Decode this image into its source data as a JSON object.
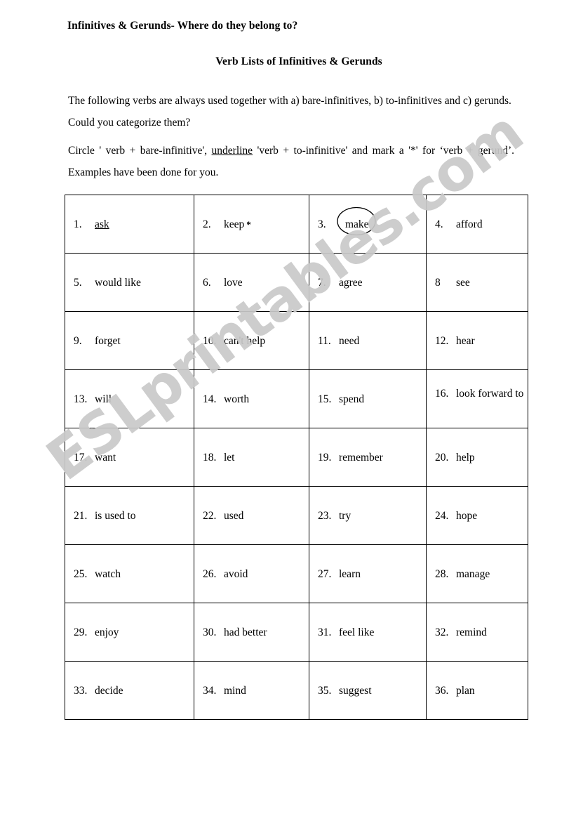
{
  "document": {
    "title_main": "Infinitives & Gerunds- Where do they belong to?",
    "title_sub": "Verb Lists of Infinitives & Gerunds",
    "intro_paragraph": "The following verbs are always used together with a) bare-infinitives, b) to-infinitives and c) gerunds.   Could you categorize them?",
    "task_line1_a": "Circle ' verb + bare-infinitive', ",
    "task_line1_underlined": "underline",
    "task_line1_b": " 'verb + to-infinitive' and mark a '*' for ‘verb +",
    "task_line2": "gerund’.   Examples have been done for you.",
    "watermark": "ESLprintables.com",
    "watermark_color": "#c9c9c9"
  },
  "table": {
    "columns": 4,
    "rows": 9,
    "cells": [
      {
        "num": "1.",
        "word": "ask",
        "mark": "underline"
      },
      {
        "num": "2.",
        "word": "keep",
        "mark": "asterisk"
      },
      {
        "num": "3.",
        "word": "make",
        "mark": "circle"
      },
      {
        "num": "4.",
        "word": "afford",
        "mark": "none"
      },
      {
        "num": "5.",
        "word": "would like",
        "mark": "none"
      },
      {
        "num": "6.",
        "word": "love",
        "mark": "none"
      },
      {
        "num": "7.",
        "word": "agree",
        "mark": "none"
      },
      {
        "num": "8",
        "word": "see",
        "mark": "none"
      },
      {
        "num": "9.",
        "word": "forget",
        "mark": "none"
      },
      {
        "num": "10.",
        "word": "can't help",
        "mark": "none"
      },
      {
        "num": "11.",
        "word": "need",
        "mark": "none"
      },
      {
        "num": "12.",
        "word": "hear",
        "mark": "none"
      },
      {
        "num": "13.",
        "word": "will",
        "mark": "none"
      },
      {
        "num": "14.",
        "word": "worth",
        "mark": "none"
      },
      {
        "num": "15.",
        "word": "spend",
        "mark": "none"
      },
      {
        "num": "16.",
        "word": "look forward to",
        "mark": "none",
        "wrap": true
      },
      {
        "num": "17.",
        "word": "want",
        "mark": "none"
      },
      {
        "num": "18.",
        "word": "let",
        "mark": "none"
      },
      {
        "num": "19.",
        "word": "remember",
        "mark": "none"
      },
      {
        "num": "20.",
        "word": "help",
        "mark": "none"
      },
      {
        "num": "21.",
        "word": "is used to",
        "mark": "none"
      },
      {
        "num": "22.",
        "word": "used",
        "mark": "none"
      },
      {
        "num": "23.",
        "word": "try",
        "mark": "none"
      },
      {
        "num": "24.",
        "word": "hope",
        "mark": "none"
      },
      {
        "num": "25.",
        "word": "watch",
        "mark": "none"
      },
      {
        "num": "26.",
        "word": "avoid",
        "mark": "none"
      },
      {
        "num": "27.",
        "word": "learn",
        "mark": "none"
      },
      {
        "num": "28.",
        "word": "manage",
        "mark": "none"
      },
      {
        "num": "29.",
        "word": "enjoy",
        "mark": "none"
      },
      {
        "num": "30.",
        "word": "had better",
        "mark": "none"
      },
      {
        "num": "31.",
        "word": "feel like",
        "mark": "none"
      },
      {
        "num": "32.",
        "word": "remind",
        "mark": "none"
      },
      {
        "num": "33.",
        "word": "decide",
        "mark": "none"
      },
      {
        "num": "34.",
        "word": "mind",
        "mark": "none"
      },
      {
        "num": "35.",
        "word": "suggest",
        "mark": "none"
      },
      {
        "num": "36.",
        "word": "plan",
        "mark": "none"
      }
    ]
  }
}
